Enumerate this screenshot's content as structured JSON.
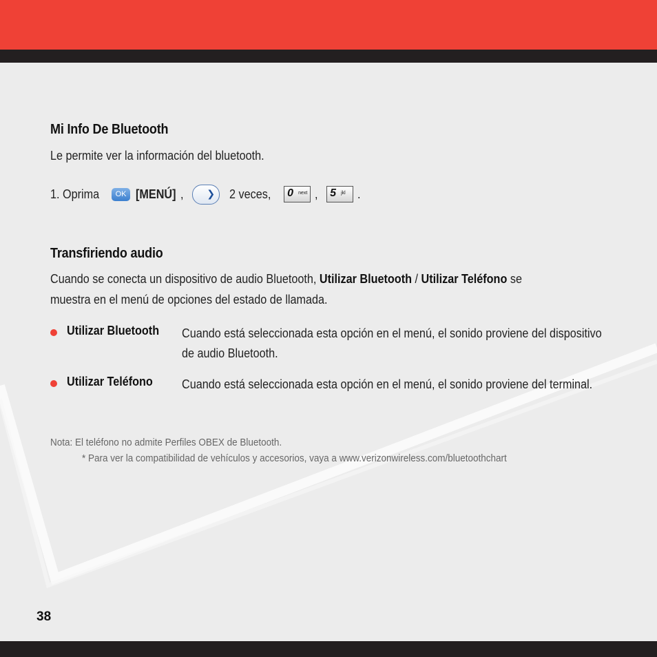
{
  "section1": {
    "title": "Mi Info De Bluetooth",
    "description": "Le permite ver la información del bluetooth.",
    "step": {
      "prefix": "1. Oprima",
      "ok_key_label": "OK",
      "menu_label": "[MENÚ]",
      "comma": ",",
      "times_text": "2 veces,",
      "key0_digit": "0",
      "key0_sub": "next",
      "comma2": ",",
      "key5_digit": "5",
      "key5_sub": "jkl",
      "period": "."
    }
  },
  "section2": {
    "title": "Transfiriendo audio",
    "para_line1_start": "Cuando se conecta un dispositivo de audio Bluetooth,",
    "para_bold1": "Utilizar Bluetooth",
    "para_sep": "/",
    "para_bold2": "Utilizar Teléfono",
    "para_line1_end": "se",
    "para_line2": "muestra en el menú de opciones del estado de llamada.",
    "bullets": [
      {
        "label": "Utilizar Bluetooth",
        "text": "Cuando está seleccionada esta opción en el menú, el sonido proviene del dispositivo de audio Bluetooth."
      },
      {
        "label": "Utilizar Teléfono",
        "text": "Cuando está seleccionada esta opción en el menú, el sonido proviene del terminal."
      }
    ]
  },
  "notes": {
    "note1": "Nota: El teléfono no admite Perfiles OBEX de Bluetooth.",
    "note2": "* Para ver la compatibilidad de vehículos y accesorios, vaya a www.verizonwireless.com/bluetoothchart"
  },
  "page_number": "38",
  "colors": {
    "accent_red": "#ef4136",
    "dark_band": "#231f20",
    "background": "#ececec"
  }
}
